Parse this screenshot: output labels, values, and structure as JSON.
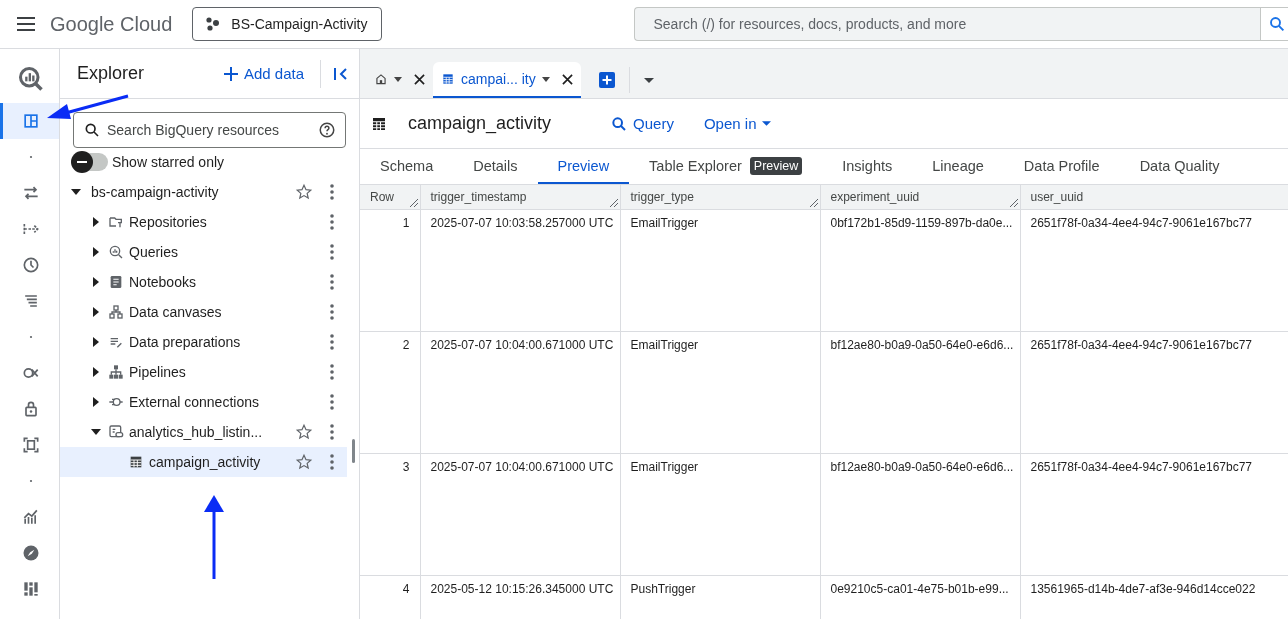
{
  "header": {
    "brand": "Google Cloud",
    "project": "BS-Campaign-Activity",
    "search_placeholder": "Search (/) for resources, docs, products, and more"
  },
  "rail": {
    "items": [
      {
        "kind": "bigquery",
        "selected": false
      },
      {
        "kind": "panel",
        "selected": true
      },
      {
        "kind": "dot",
        "selected": false
      },
      {
        "kind": "transfer",
        "selected": false
      },
      {
        "kind": "flow",
        "selected": false
      },
      {
        "kind": "clock",
        "selected": false
      },
      {
        "kind": "lines",
        "selected": false
      },
      {
        "kind": "dot",
        "selected": false
      },
      {
        "kind": "scan",
        "selected": false
      },
      {
        "kind": "lock",
        "selected": false
      },
      {
        "kind": "frame",
        "selected": false
      },
      {
        "kind": "dot",
        "selected": false
      },
      {
        "kind": "chart",
        "selected": false
      },
      {
        "kind": "compass",
        "selected": false
      },
      {
        "kind": "grid",
        "selected": false
      }
    ]
  },
  "explorer": {
    "title": "Explorer",
    "add_data": "Add data",
    "search_placeholder": "Search BigQuery resources",
    "starred_toggle": {
      "label": "Show starred only",
      "on": false
    },
    "tree": [
      {
        "label": "bs-campaign-activity",
        "expanded": true,
        "starred": false,
        "selected": false,
        "children": [
          {
            "label": "Repositories",
            "kind": "repo",
            "expanded": false,
            "selected": false
          },
          {
            "label": "Queries",
            "kind": "query",
            "expanded": false,
            "selected": false
          },
          {
            "label": "Notebooks",
            "kind": "notebook",
            "expanded": false,
            "selected": false
          },
          {
            "label": "Data canvases",
            "kind": "canvas",
            "expanded": false,
            "selected": false
          },
          {
            "label": "Data preparations",
            "kind": "prep",
            "expanded": false,
            "selected": false
          },
          {
            "label": "Pipelines",
            "kind": "pipeline",
            "expanded": false,
            "selected": false
          },
          {
            "label": "External connections",
            "kind": "connection",
            "expanded": false,
            "selected": false
          },
          {
            "label": "analytics_hub_listin...",
            "kind": "dataset",
            "expanded": true,
            "starred": false,
            "selected": false,
            "children": [
              {
                "label": "campaign_activity",
                "kind": "table",
                "starred": false,
                "selected": true
              }
            ]
          }
        ]
      }
    ]
  },
  "tabs": [
    {
      "kind": "home",
      "selected": false
    },
    {
      "kind": "table",
      "label": "campai... ity",
      "selected": true
    }
  ],
  "table_header": {
    "title": "campaign_activity",
    "query": "Query",
    "open_in": "Open in"
  },
  "subtabs": [
    {
      "label": "Schema",
      "selected": false
    },
    {
      "label": "Details",
      "selected": false
    },
    {
      "label": "Preview",
      "selected": true
    },
    {
      "label": "Table Explorer",
      "badge": "Preview",
      "selected": false
    },
    {
      "label": "Insights",
      "selected": false
    },
    {
      "label": "Lineage",
      "selected": false
    },
    {
      "label": "Data Profile",
      "selected": false
    },
    {
      "label": "Data Quality",
      "selected": false
    }
  ],
  "table": {
    "columns": [
      "Row",
      "trigger_timestamp",
      "trigger_type",
      "experiment_uuid",
      "user_uuid"
    ],
    "rows": [
      [
        "1",
        "2025-07-07 10:03:58.257000 UTC",
        "EmailTrigger",
        "0bf172b1-85d9-1159-897b-da0e...",
        "2651f78f-0a34-4ee4-94c7-9061e167bc77"
      ],
      [
        "2",
        "2025-07-07 10:04:00.671000 UTC",
        "EmailTrigger",
        "bf12ae80-b0a9-0a50-64e0-e6d6...",
        "2651f78f-0a34-4ee4-94c7-9061e167bc77"
      ],
      [
        "3",
        "2025-07-07 10:04:00.671000 UTC",
        "EmailTrigger",
        "bf12ae80-b0a9-0a50-64e0-e6d6...",
        "2651f78f-0a34-4ee4-94c7-9061e167bc77"
      ],
      [
        "4",
        "2025-05-12 10:15:26.345000 UTC",
        "PushTrigger",
        "0e9210c5-ca01-4e75-b01b-e99...",
        "13561965-d14b-4de7-af3e-946d14cce022"
      ]
    ]
  }
}
